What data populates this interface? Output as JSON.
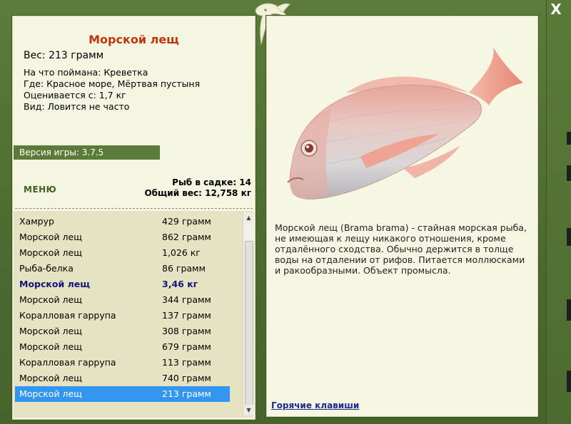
{
  "window": {
    "close_label": "X",
    "accent_color": "#4f6e31"
  },
  "fish_card": {
    "title": "Морской лещ",
    "weight_line": "Вес: 213 грамм",
    "details": [
      "На что поймана: Креветка",
      "Где: Красное море, Мёртвая пустыня",
      "Оценивается с: 1,7 кг",
      "Вид: Ловится не часто"
    ]
  },
  "version": "Версия игры: 3.7.5",
  "menu_label": "МЕНЮ",
  "stats": {
    "fish_in_pond": "Рыб в садке: 14",
    "total_weight": "Общий вес: 12,758 кг"
  },
  "catch_list": [
    {
      "name": "Хамрур",
      "weight": "429 грамм"
    },
    {
      "name": "Морской лещ",
      "weight": "862 грамм"
    },
    {
      "name": "Морской лещ",
      "weight": "1,026 кг"
    },
    {
      "name": "Рыба-белка",
      "weight": "86 грамм"
    },
    {
      "name": "Морской лещ",
      "weight": "3,46 кг"
    },
    {
      "name": "Морской лещ",
      "weight": "344 грамм"
    },
    {
      "name": "Коралловая гаррупа",
      "weight": "137 грамм"
    },
    {
      "name": "Морской лещ",
      "weight": "308 грамм"
    },
    {
      "name": "Морской лещ",
      "weight": "679 грамм"
    },
    {
      "name": "Коралловая гаррупа",
      "weight": "113 грамм"
    },
    {
      "name": "Морской лещ",
      "weight": "740 грамм"
    },
    {
      "name": "Морской лещ",
      "weight": "213 грамм"
    }
  ],
  "description": "Морской лещ (Brama brama) - стайная морская рыба, не имеющая к лещу никакого отношения, кроме отдалённого сходства. Обычно держится в толще воды на отдалении от рифов. Питается моллюсками и ракообразными. Объект промысла.",
  "hotkeys_label": "Горячие клавиши"
}
